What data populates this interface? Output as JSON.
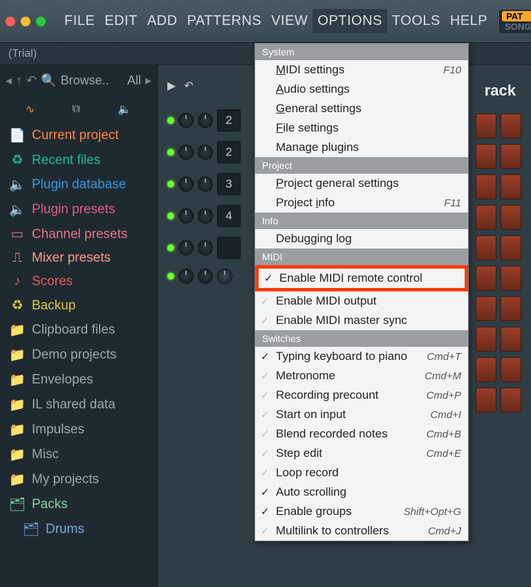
{
  "menubar": [
    "FILE",
    "EDIT",
    "ADD",
    "PATTERNS",
    "VIEW",
    "OPTIONS",
    "TOOLS",
    "HELP"
  ],
  "active_menu_index": 5,
  "mode": {
    "pat": "PAT",
    "song": "SONG"
  },
  "subbar": {
    "trial": "(Trial)"
  },
  "browser": {
    "toolbar_label": "Browse..",
    "toolbar_filter": "All",
    "items": [
      {
        "label": "Current project",
        "color": "c-orange",
        "icon": "file"
      },
      {
        "label": "Recent files",
        "color": "c-teal",
        "icon": "recycle"
      },
      {
        "label": "Plugin database",
        "color": "c-blue",
        "icon": "speaker"
      },
      {
        "label": "Plugin presets",
        "color": "c-pink",
        "icon": "speaker"
      },
      {
        "label": "Channel presets",
        "color": "c-rose",
        "icon": "preset"
      },
      {
        "label": "Mixer presets",
        "color": "c-salmon",
        "icon": "sliders"
      },
      {
        "label": "Scores",
        "color": "c-red",
        "icon": "note"
      },
      {
        "label": "Backup",
        "color": "c-yellow",
        "icon": "recycle"
      },
      {
        "label": "Clipboard files",
        "color": "c-gray",
        "icon": "folder"
      },
      {
        "label": "Demo projects",
        "color": "c-gray",
        "icon": "folder"
      },
      {
        "label": "Envelopes",
        "color": "c-gray",
        "icon": "folder"
      },
      {
        "label": "IL shared data",
        "color": "c-gray",
        "icon": "folder"
      },
      {
        "label": "Impulses",
        "color": "c-gray",
        "icon": "folder"
      },
      {
        "label": "Misc",
        "color": "c-gray",
        "icon": "folder"
      },
      {
        "label": "My projects",
        "color": "c-gray",
        "icon": "folder"
      },
      {
        "label": "Packs",
        "color": "c-mint",
        "icon": "packs"
      }
    ],
    "subitem": {
      "label": "Drums",
      "color": "c-lightblue"
    }
  },
  "sequencer": {
    "track_label": "rack",
    "channels": [
      "2",
      "2",
      "3",
      "4",
      "",
      ""
    ]
  },
  "dropdown": {
    "sections": [
      {
        "header": "System",
        "items": [
          {
            "label_pre": "",
            "und": "M",
            "label_post": "IDI settings",
            "shortcut": "F10"
          },
          {
            "label_pre": "",
            "und": "A",
            "label_post": "udio settings"
          },
          {
            "label_pre": "",
            "und": "G",
            "label_post": "eneral settings"
          },
          {
            "label_pre": "",
            "und": "F",
            "label_post": "ile settings"
          },
          {
            "label_pre": "Manage plugins",
            "und": "",
            "label_post": ""
          }
        ]
      },
      {
        "header": "Project",
        "items": [
          {
            "label_pre": "",
            "und": "P",
            "label_post": "roject general settings"
          },
          {
            "label_pre": "Project ",
            "und": "i",
            "label_post": "nfo",
            "shortcut": "F11"
          }
        ]
      },
      {
        "header": "Info",
        "items": [
          {
            "label_pre": "Debugging log",
            "und": "",
            "label_post": ""
          }
        ]
      },
      {
        "header": "MIDI",
        "items": [
          {
            "label_pre": "Enable MIDI remote control",
            "checked": true,
            "highlight": true
          },
          {
            "label_pre": "Enable MIDI output",
            "dim_check": true
          },
          {
            "label_pre": "Enable MIDI master sync",
            "dim_check": true
          }
        ]
      },
      {
        "header": "Switches",
        "items": [
          {
            "label_pre": "Typing keyboard to piano",
            "checked": true,
            "shortcut": "Cmd+T"
          },
          {
            "label_pre": "Metronome",
            "dim_check": true,
            "shortcut": "Cmd+M"
          },
          {
            "label_pre": "Recording precount",
            "dim_check": true,
            "shortcut": "Cmd+P"
          },
          {
            "label_pre": "Start on input",
            "dim_check": true,
            "shortcut": "Cmd+I"
          },
          {
            "label_pre": "Blend recorded notes",
            "dim_check": true,
            "shortcut": "Cmd+B"
          },
          {
            "label_pre": "Step edit",
            "dim_check": true,
            "shortcut": "Cmd+E"
          },
          {
            "label_pre": "Loop record",
            "dim_check": true
          },
          {
            "label_pre": "Auto scrolling",
            "checked": true
          },
          {
            "label_pre": "Enable groups",
            "checked": true,
            "shortcut": "Shift+Opt+G"
          },
          {
            "label_pre": "Multilink to controllers",
            "dim_check": true,
            "shortcut": "Cmd+J"
          }
        ]
      }
    ]
  }
}
